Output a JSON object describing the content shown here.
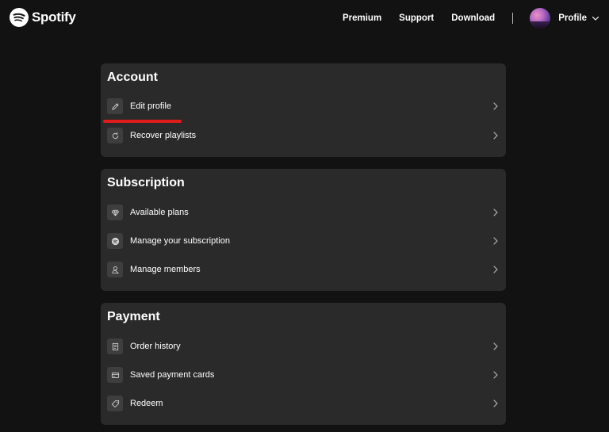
{
  "brand": {
    "name": "Spotify",
    "color": "#ffffff"
  },
  "nav": {
    "links": [
      {
        "label": "Premium"
      },
      {
        "label": "Support"
      },
      {
        "label": "Download"
      }
    ],
    "profile_label": "Profile"
  },
  "sections": [
    {
      "title": "Account",
      "items": [
        {
          "label": "Edit profile",
          "icon": "pencil-icon"
        },
        {
          "label": "Recover playlists",
          "icon": "refresh-icon"
        }
      ]
    },
    {
      "title": "Subscription",
      "items": [
        {
          "label": "Available plans",
          "icon": "diamond-icon"
        },
        {
          "label": "Manage your subscription",
          "icon": "spotify-icon"
        },
        {
          "label": "Manage members",
          "icon": "user-icon"
        }
      ]
    },
    {
      "title": "Payment",
      "items": [
        {
          "label": "Order history",
          "icon": "receipt-icon"
        },
        {
          "label": "Saved payment cards",
          "icon": "card-icon"
        },
        {
          "label": "Redeem",
          "icon": "tag-icon"
        }
      ]
    }
  ],
  "colors": {
    "background": "#121212",
    "card": "#2a2a2a",
    "icon_tile": "#3e3e3e",
    "annotation": "#e01b1b"
  }
}
